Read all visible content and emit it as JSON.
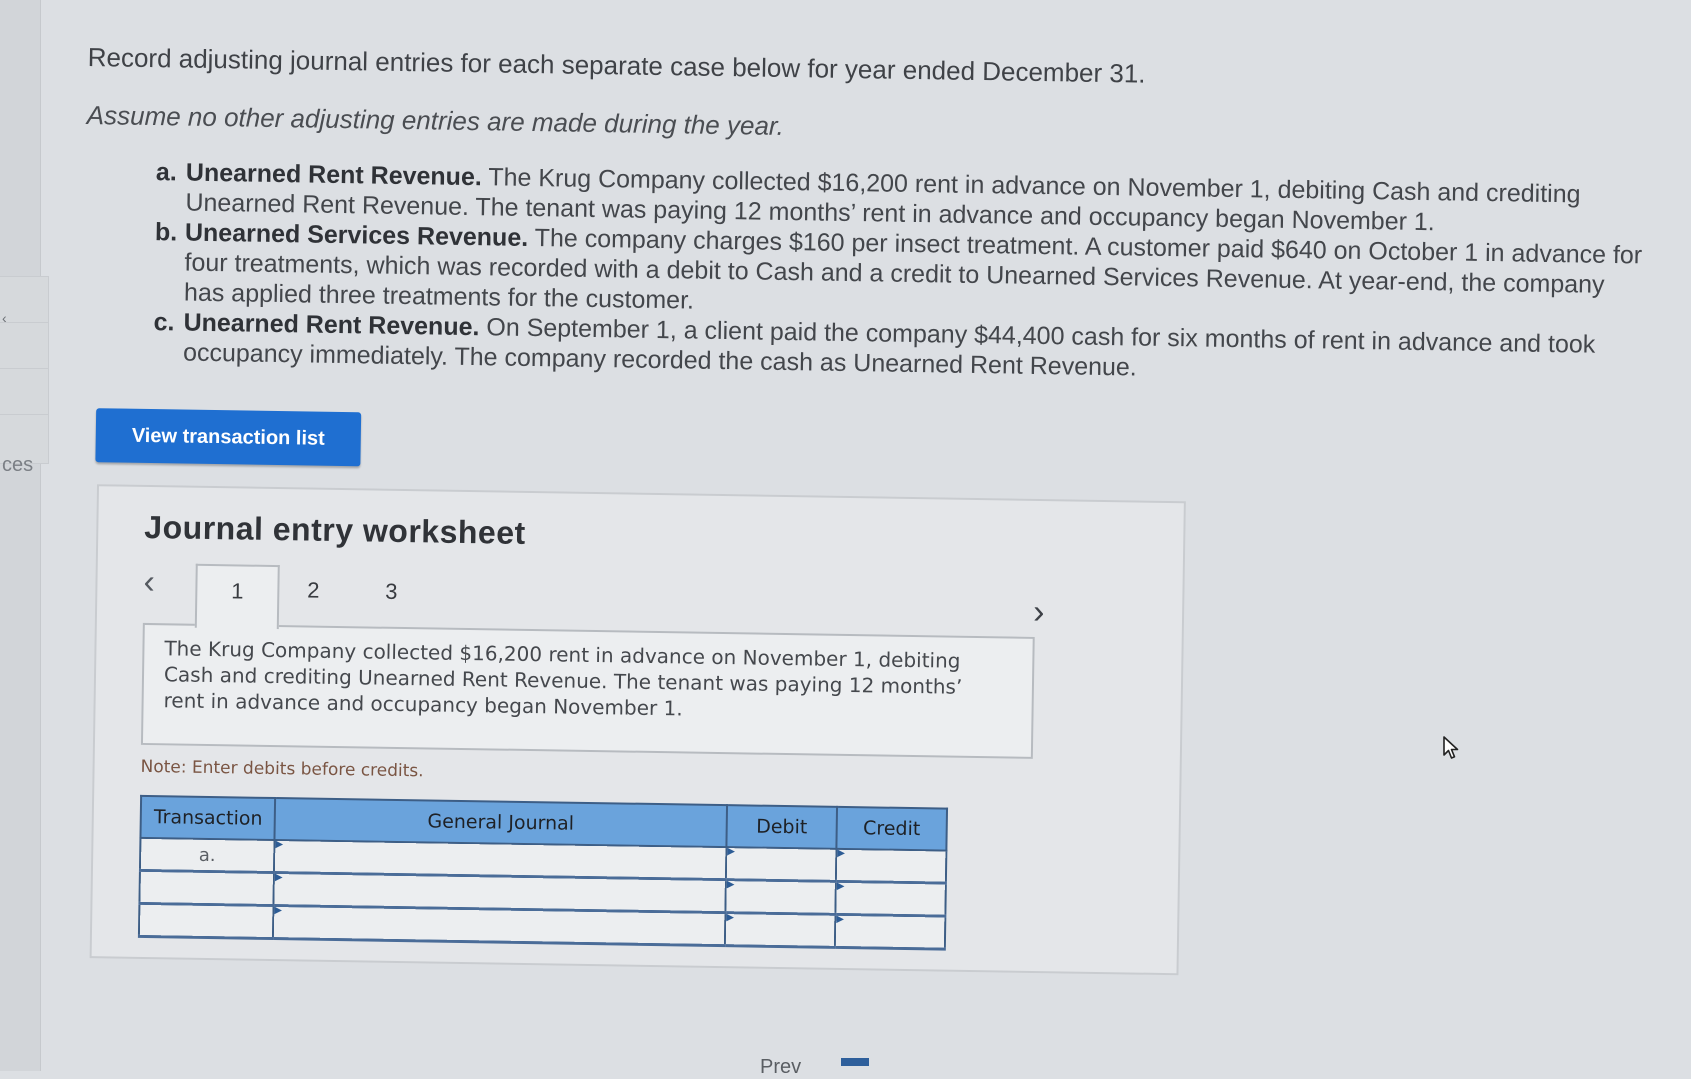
{
  "sidebar": {
    "tab_label": "ces",
    "arrow": "‹"
  },
  "instructions": {
    "line1": "Record adjusting journal entries for each separate case below for year ended December 31.",
    "line2": "Assume no other adjusting entries are made during the year."
  },
  "cases": [
    {
      "letter": "a.",
      "title": "Unearned Rent Revenue.",
      "text": "The Krug Company collected $16,200 rent in advance on November 1, debiting Cash and crediting Unearned Rent Revenue. The tenant was paying 12 months’ rent in advance and occupancy began November 1."
    },
    {
      "letter": "b.",
      "title": "Unearned Services Revenue.",
      "text": "The company charges $160 per insect treatment. A customer paid $640 on October 1 in advance for four treatments, which was recorded with a debit to Cash and a credit to Unearned Services Revenue. At year-end, the company has applied three treatments for the customer."
    },
    {
      "letter": "c.",
      "title": "Unearned Rent Revenue.",
      "text": "On September 1, a client paid the company $44,400 cash for six months of rent in advance and took occupancy immediately. The company recorded the cash as Unearned Rent Revenue."
    }
  ],
  "view_button": {
    "label": "View transaction list"
  },
  "worksheet": {
    "title": "Journal entry worksheet",
    "prev_icon": "‹",
    "next_icon": "›",
    "tabs": [
      "1",
      "2",
      "3"
    ],
    "active_tab": "1",
    "description": "The Krug Company collected $16,200 rent in advance on November 1, debiting Cash and crediting Unearned Rent Revenue. The tenant was paying 12 months’ rent in advance and occupancy began November 1.",
    "note": "Note: Enter debits before credits.",
    "table": {
      "headers": [
        "Transaction",
        "General Journal",
        "Debit",
        "Credit"
      ],
      "rows": [
        {
          "transaction": "a.",
          "account": "",
          "debit": "",
          "credit": ""
        },
        {
          "transaction": "",
          "account": "",
          "debit": "",
          "credit": ""
        },
        {
          "transaction": "",
          "account": "",
          "debit": "",
          "credit": ""
        }
      ]
    }
  },
  "bottom_nav": {
    "prev_label": "Prev"
  },
  "colors": {
    "primary_button": "#1f6fd1",
    "table_header": "#6aa3dc",
    "table_border": "#3d5e86"
  }
}
